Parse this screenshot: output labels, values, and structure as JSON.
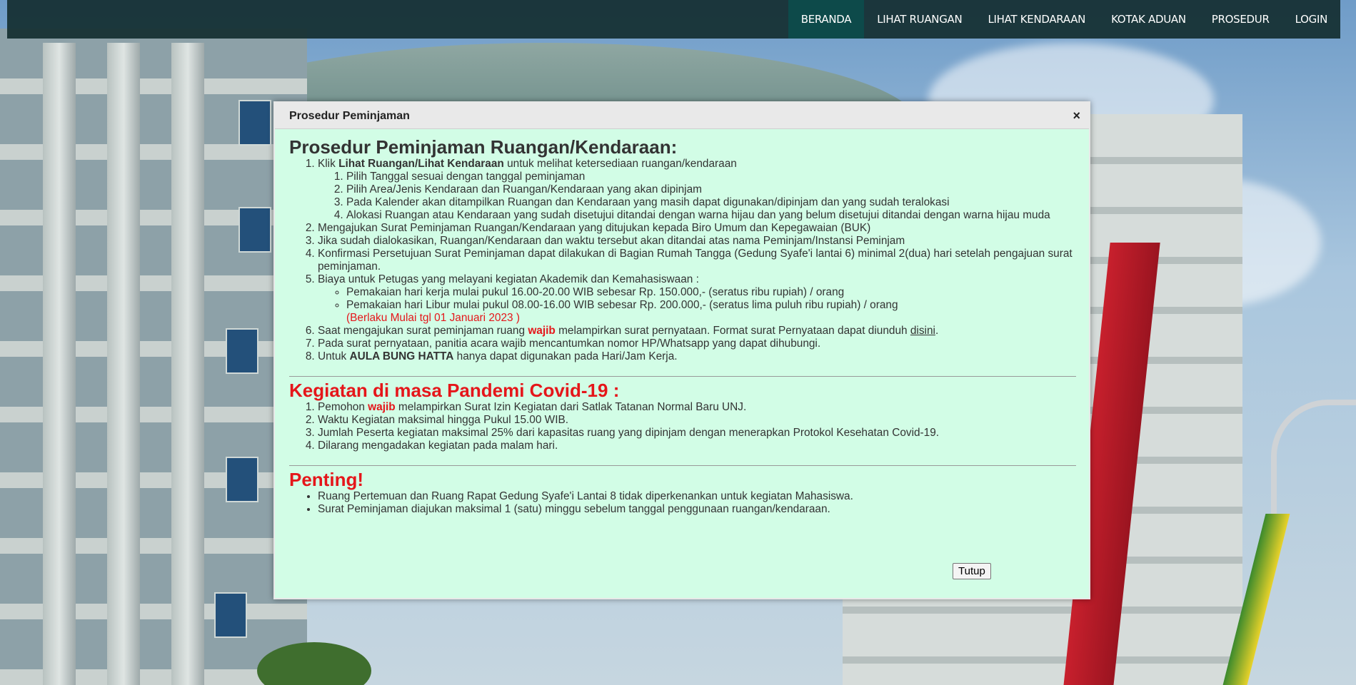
{
  "navbar": {
    "items": [
      {
        "label": "BERANDA",
        "active": true
      },
      {
        "label": "LIHAT RUANGAN",
        "active": false
      },
      {
        "label": "LIHAT KENDARAAN",
        "active": false
      },
      {
        "label": "KOTAK ADUAN",
        "active": false
      },
      {
        "label": "PROSEDUR",
        "active": false
      },
      {
        "label": "LOGIN",
        "active": false
      }
    ]
  },
  "modal": {
    "title": "Prosedur Peminjaman",
    "close_icon": "×",
    "heading": "Prosedur Peminjaman Ruangan/Kendaraan:",
    "steps": {
      "s1_pre": "Klik ",
      "s1_bold": "Lihat Ruangan/Lihat Kendaraan",
      "s1_post": " untuk melihat ketersediaan ruangan/kendaraan",
      "s1_sub": [
        "Pilih Tanggal sesuai dengan tanggal peminjaman",
        "Pilih Area/Jenis Kendaraan dan Ruangan/Kendaraan yang akan dipinjam",
        "Pada Kalender akan ditampilkan Ruangan dan Kendaraan yang masih dapat digunakan/dipinjam dan yang sudah teralokasi",
        "Alokasi Ruangan atau Kendaraan yang sudah disetujui ditandai dengan warna hijau dan yang belum disetujui ditandai dengan warna hijau muda"
      ],
      "s2": "Mengajukan Surat Peminjaman Ruangan/Kendaraan yang ditujukan kepada Biro Umum dan Kepegawaian (BUK)",
      "s3": "Jika sudah dialokasikan, Ruangan/Kendaraan dan waktu tersebut akan ditandai atas nama Peminjam/Instansi Peminjam",
      "s4": "Konfirmasi Persetujuan Surat Peminjaman dapat dilakukan di Bagian Rumah Tangga (Gedung Syafe'i lantai 6) minimal 2(dua) hari setelah pengajuan surat peminjaman.",
      "s5": "Biaya untuk Petugas yang melayani kegiatan Akademik dan Kemahasiswaan :",
      "s5_sub1": "Pemakaian hari kerja mulai pukul 16.00-20.00 WIB sebesar Rp. 150.000,- (seratus ribu rupiah) / orang",
      "s5_sub2": "Pemakaian hari Libur mulai pukul 08.00-16.00 WIB sebesar Rp. 200.000,- (seratus lima puluh ribu rupiah) / orang",
      "s5_note": "(Berlaku Mulai tgl 01 Januari 2023 )",
      "s6_pre": "Saat mengajukan surat peminjaman ruang ",
      "s6_wajib": "wajib",
      "s6_mid": " melampirkan surat pernyataan. Format surat Pernyataan dapat diunduh ",
      "s6_link": "disini",
      "s6_post": ".",
      "s7": "Pada surat pernyataan, panitia acara wajib mencantumkan nomor HP/Whatsapp yang dapat dihubungi.",
      "s8_pre": "Untuk ",
      "s8_bold": "AULA BUNG HATTA",
      "s8_post": " hanya dapat digunakan pada Hari/Jam Kerja."
    },
    "covid_heading": "Kegiatan di masa Pandemi Covid-19 :",
    "covid": {
      "c1_pre": "Pemohon ",
      "c1_wajib": "wajib",
      "c1_post": " melampirkan Surat Izin Kegiatan dari Satlak Tatanan Normal Baru UNJ.",
      "c2": "Waktu Kegiatan maksimal hingga Pukul 15.00 WIB.",
      "c3": "Jumlah Peserta kegiatan maksimal 25% dari kapasitas ruang yang dipinjam dengan menerapkan Protokol Kesehatan Covid-19.",
      "c4": "Dilarang mengadakan kegiatan pada malam hari."
    },
    "penting_heading": "Penting!",
    "penting": [
      "Ruang Pertemuan dan Ruang Rapat Gedung Syafe'i Lantai 8 tidak diperkenankan untuk kegiatan Mahasiswa.",
      "Surat Peminjaman diajukan maksimal 1 (satu) minggu sebelum tanggal penggunaan ruangan/kendaraan."
    ],
    "close_button": "Tutup"
  }
}
